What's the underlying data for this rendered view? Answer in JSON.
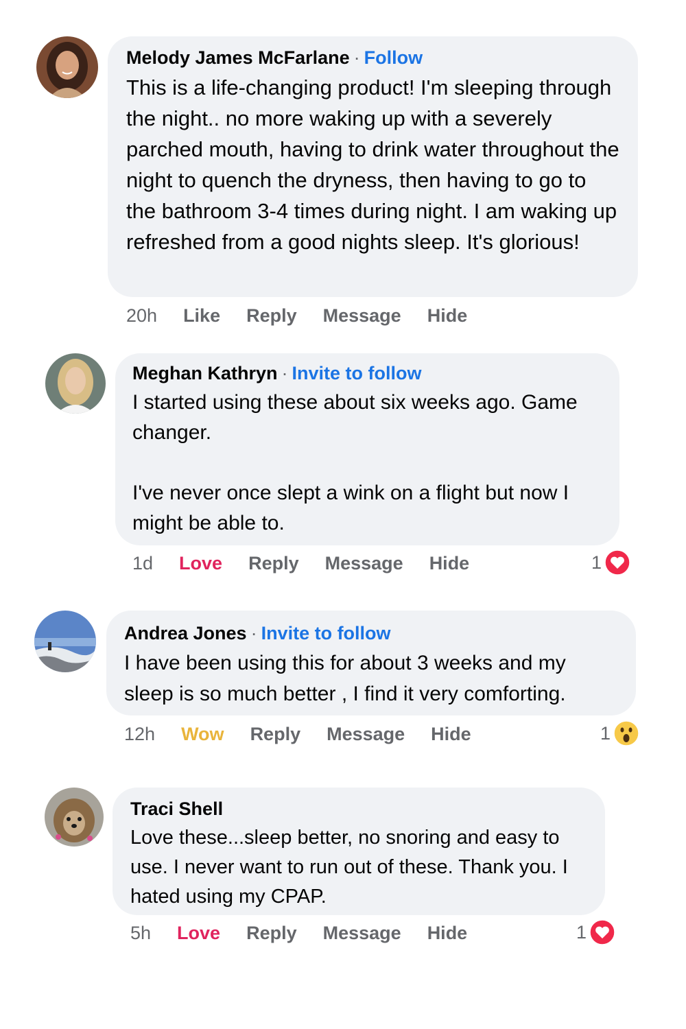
{
  "comments": [
    {
      "name": "Melody James McFarlane",
      "separator": "·",
      "follow_label": "Follow",
      "text": [
        "This is a life-changing product! I'm sleeping through the night.. no more waking up with a severely parched mouth, having to drink water throughout the night to quench the dryness, then having to go to the bathroom 3-4 times during night. I am waking up refreshed from a good nights sleep. It's glorious!"
      ],
      "time": "20h",
      "reaction_label": "Like",
      "reply_label": "Reply",
      "message_label": "Message",
      "hide_label": "Hide"
    },
    {
      "name": "Meghan Kathryn",
      "separator": "·",
      "follow_label": "Invite to follow",
      "text": [
        "I started using these about six weeks ago. Game changer.",
        "I've never once slept a wink on a flight but now I might be able to."
      ],
      "time": "1d",
      "reaction_label": "Love",
      "reply_label": "Reply",
      "message_label": "Message",
      "hide_label": "Hide",
      "reaction_count": "1",
      "reaction_icon": "heart-icon"
    },
    {
      "name": "Andrea Jones",
      "separator": "·",
      "follow_label": "Invite to follow",
      "text": [
        "I have been using this for about 3 weeks and my sleep is so much better , I find it very comforting."
      ],
      "time": "12h",
      "reaction_label": "Wow",
      "reply_label": "Reply",
      "message_label": "Message",
      "hide_label": "Hide",
      "reaction_count": "1",
      "reaction_icon": "wow-face-icon"
    },
    {
      "name": "Traci Shell",
      "text": [
        "Love these...sleep better, no snoring and easy to use. I never want to run out of these. Thank you. I hated using my CPAP."
      ],
      "time": "5h",
      "reaction_label": "Love",
      "reply_label": "Reply",
      "message_label": "Message",
      "hide_label": "Hide",
      "reaction_count": "1",
      "reaction_icon": "heart-icon"
    }
  ],
  "colors": {
    "bubble": "#f0f2f5",
    "follow_link": "#1b74e4",
    "love": "#e0245e",
    "wow": "#e9b43b",
    "meta": "#65676b"
  }
}
